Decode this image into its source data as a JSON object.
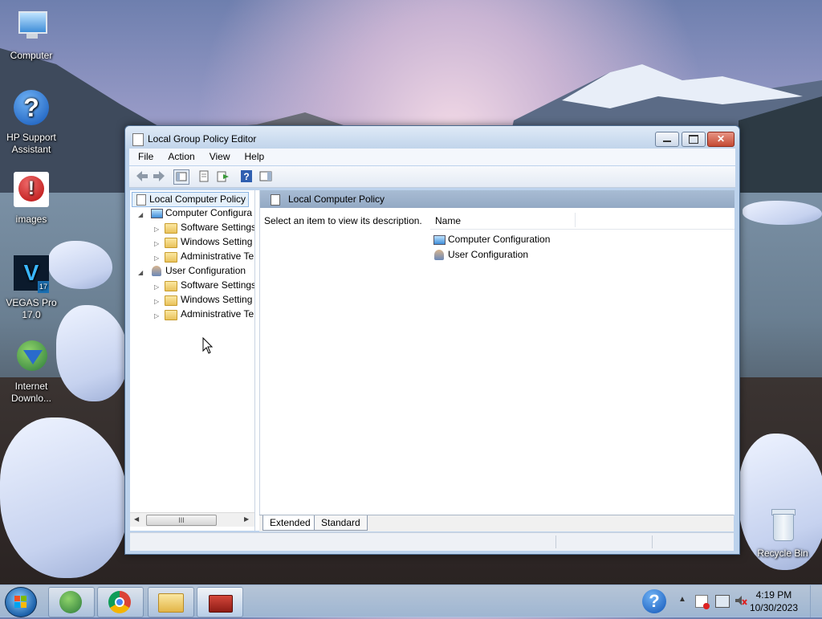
{
  "desktop": {
    "icons": [
      {
        "label": "Computer",
        "icon": "computer-icon"
      },
      {
        "label": "HP Support Assistant",
        "icon": "help-icon"
      },
      {
        "label": "images",
        "icon": "alert-icon"
      },
      {
        "label": "VEGAS Pro 17.0",
        "icon": "vegas-icon",
        "badge": "V",
        "version": "17"
      },
      {
        "label": "Internet Downlo...",
        "icon": "idm-icon"
      },
      {
        "label": "Recycle Bin",
        "icon": "recycle-bin-icon"
      }
    ]
  },
  "window": {
    "title": "Local Group Policy Editor",
    "close_glyph": "✕",
    "menu": [
      "File",
      "Action",
      "View",
      "Help"
    ],
    "tree": {
      "root": "Local Computer Policy",
      "computer": "Computer Configura",
      "computer_children": [
        "Software Settings",
        "Windows Setting",
        "Administrative Te"
      ],
      "user": "User Configuration",
      "user_children": [
        "Software Settings",
        "Windows Setting",
        "Administrative Te"
      ]
    },
    "scroll_thumb_glyph": "III",
    "right": {
      "header": "Local Computer Policy",
      "description": "Select an item to view its description.",
      "column_name": "Name",
      "items": [
        "Computer Configuration",
        "User Configuration"
      ]
    },
    "tabs": [
      "Extended",
      "Standard"
    ]
  },
  "taskbar": {
    "time": "4:19 PM",
    "date": "10/30/2023",
    "apps": [
      "Internet Download Manager",
      "Google Chrome",
      "File Explorer",
      "Toolbox"
    ],
    "tray_glyph": "▲"
  },
  "colors": {
    "accent": "#3f8ed8",
    "window_frame": "#bcd2ec",
    "close_button": "#c44a33"
  }
}
